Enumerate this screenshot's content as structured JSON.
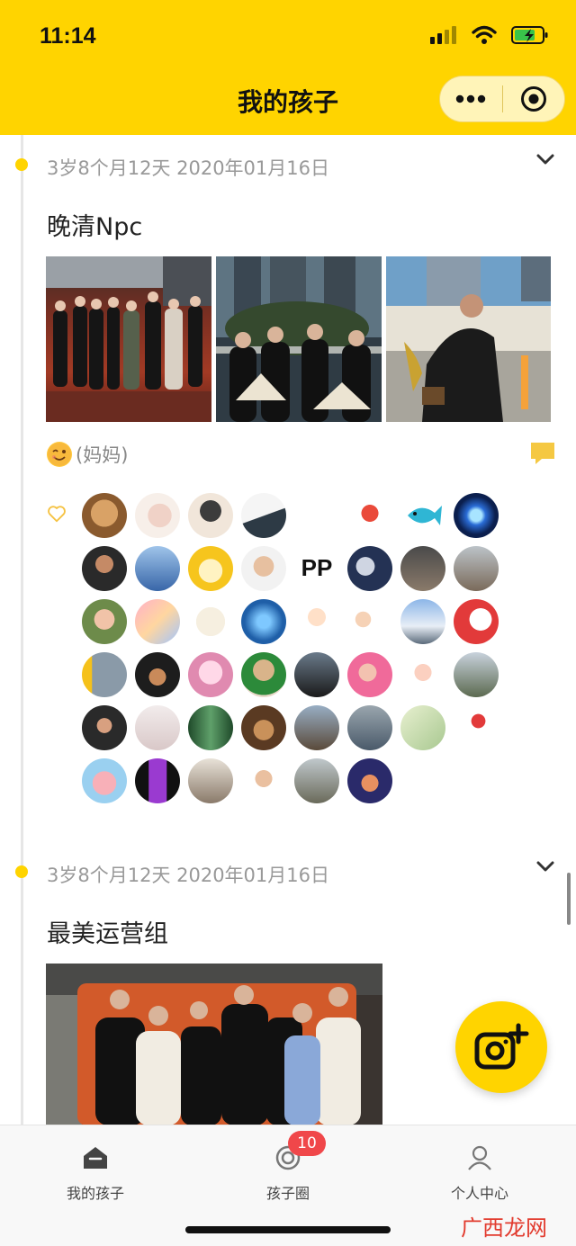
{
  "status_bar": {
    "time": "11:14"
  },
  "nav": {
    "title": "我的孩子"
  },
  "posts": [
    {
      "date": "3岁8个月12天 2020年01月16日",
      "title": "晚清Npc",
      "author": "(妈妈)",
      "likes_count_avatars": 42
    },
    {
      "date": "3岁8个月12天 2020年01月16日",
      "title": "最美运营组"
    }
  ],
  "tabbar": {
    "items": [
      {
        "label": "我的孩子",
        "icon": "home-icon"
      },
      {
        "label": "孩子圈",
        "icon": "circle-icon",
        "badge": "10"
      },
      {
        "label": "个人中心",
        "icon": "user-icon"
      }
    ]
  },
  "watermark": "广西龙网",
  "colors": {
    "accent": "#FFD400",
    "badge": "#F0474A"
  }
}
